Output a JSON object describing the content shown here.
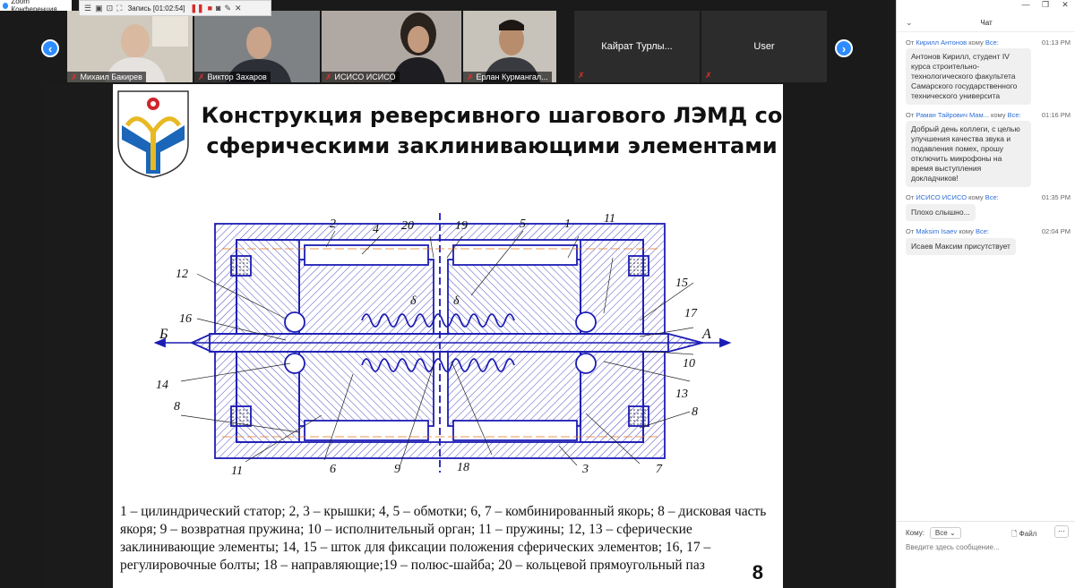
{
  "window": {
    "title": "Zoom Конференция"
  },
  "recording": {
    "label": "Запись [01:02:54]"
  },
  "participants": [
    {
      "name": "Михаил Бакирев"
    },
    {
      "name": "Виктор Захаров"
    },
    {
      "name": "ИСИСО ИСИСО"
    },
    {
      "name": "Ерлан Курмангал..."
    },
    {
      "name": "Кайрат Турлы..."
    },
    {
      "name": "User"
    }
  ],
  "slide": {
    "title": "Конструкция реверсивного шагового ЛЭМД со сферическими заклинивающими элементами",
    "legend": "1 – цилиндрический статор; 2, 3 – крышки; 4, 5 – обмотки; 6, 7 – комбинированный якорь; 8 – дисковая часть якоря; 9 – возвратная пружина; 10 – исполнительный орган; 11 – пружины; 12, 13 – сферические заклинивающие элементы; 14, 15 – шток для фиксации положения сферических элементов; 16, 17 – регулировочные болты; 18 – направляющие;19 – полюс-шайба; 20 – кольцевой прямоугольный паз",
    "page": "8",
    "labels": {
      "n1": "1",
      "n2": "2",
      "n3": "3",
      "n4": "4",
      "n5": "5",
      "n6": "6",
      "n7": "7",
      "n8a": "8",
      "n8b": "8",
      "n9": "9",
      "n10": "10",
      "n11a": "11",
      "n11b": "11",
      "n12": "12",
      "n13": "13",
      "n14": "14",
      "n15": "15",
      "n16": "16",
      "n17": "17",
      "n18": "18",
      "n19": "19",
      "n20": "20",
      "d1": "δ",
      "d2": "δ",
      "A": "A",
      "B": "Б"
    }
  },
  "chat": {
    "title": "Чат",
    "messages": [
      {
        "from": "Кирилл Антонов",
        "to": "Все:",
        "prefix": "От",
        "mid": "кому",
        "time": "01:13 PM",
        "text": "Антонов Кирилл, студент IV курса строительно-технологического факультета Самарского государственного технического университа"
      },
      {
        "from": "Раман Тайрович Мам...",
        "to": "Все:",
        "prefix": "От",
        "mid": "кому",
        "time": "01:16 PM",
        "text": "Добрый день коллеги, с целью улучшения качества звука и подавления помех, прошу отключить микрофоны на время выступления докладчиков!"
      },
      {
        "from": "ИСИСО ИСИСО",
        "to": "Все:",
        "prefix": "От",
        "mid": "кому",
        "time": "01:35 PM",
        "text": "Плохо слышно..."
      },
      {
        "from": "Maksim Isaev",
        "to": "Все:",
        "prefix": "От",
        "mid": "кому",
        "time": "02:04 PM",
        "text": "Исаев Максим присутствует"
      }
    ],
    "composer": {
      "to_label": "Кому:",
      "to_value": "Все",
      "file_label": "Файл",
      "placeholder": "Введите здесь сообщение..."
    }
  },
  "colors": {
    "zoom_blue": "#2d8cff",
    "drawing_blue": "#1c1cb4",
    "record_red": "#d42a2a"
  }
}
